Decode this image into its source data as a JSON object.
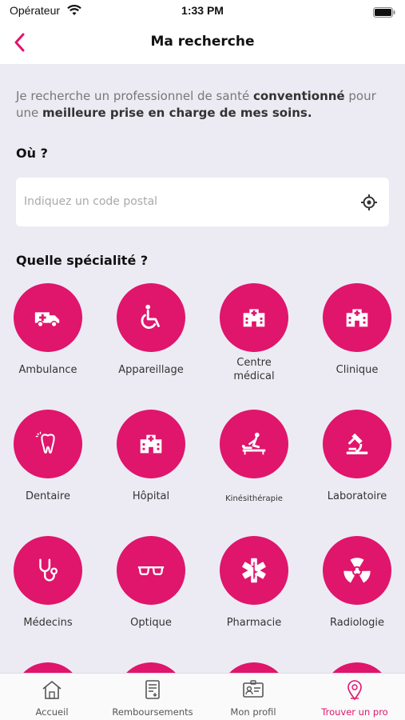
{
  "status_bar": {
    "carrier": "Opérateur",
    "time": "1:33 PM"
  },
  "header": {
    "title": "Ma recherche"
  },
  "intro": {
    "part1": "Je recherche un professionnel de santé ",
    "bold1": "conventionné",
    "part2": " pour une ",
    "bold2": "meilleure prise en charge de mes soins."
  },
  "location": {
    "question": "Où ?",
    "placeholder": "Indiquez un code postal",
    "value": ""
  },
  "specialty": {
    "question": "Quelle spécialité ?",
    "items": [
      {
        "label": "Ambulance",
        "icon": "ambulance-icon"
      },
      {
        "label": "Appareillage",
        "icon": "wheelchair-icon"
      },
      {
        "label": "Centre médical",
        "icon": "medical-center-icon"
      },
      {
        "label": "Clinique",
        "icon": "clinic-icon"
      },
      {
        "label": "Dentaire",
        "icon": "tooth-icon"
      },
      {
        "label": "Hôpital",
        "icon": "hospital-icon"
      },
      {
        "label": "Kinésithérapie",
        "icon": "physiotherapy-icon"
      },
      {
        "label": "Laboratoire",
        "icon": "microscope-icon"
      },
      {
        "label": "Médecins",
        "icon": "stethoscope-icon"
      },
      {
        "label": "Optique",
        "icon": "glasses-icon"
      },
      {
        "label": "Pharmacie",
        "icon": "star-of-life-icon"
      },
      {
        "label": "Radiologie",
        "icon": "radiation-icon"
      }
    ]
  },
  "tabs": [
    {
      "label": "Accueil",
      "icon": "home-icon",
      "active": false
    },
    {
      "label": "Remboursements",
      "icon": "document-icon",
      "active": false
    },
    {
      "label": "Mon profil",
      "icon": "profile-card-icon",
      "active": false
    },
    {
      "label": "Trouver un pro",
      "icon": "location-pin-icon",
      "active": true
    }
  ],
  "colors": {
    "accent": "#e0156c",
    "background": "#ecebf3"
  }
}
